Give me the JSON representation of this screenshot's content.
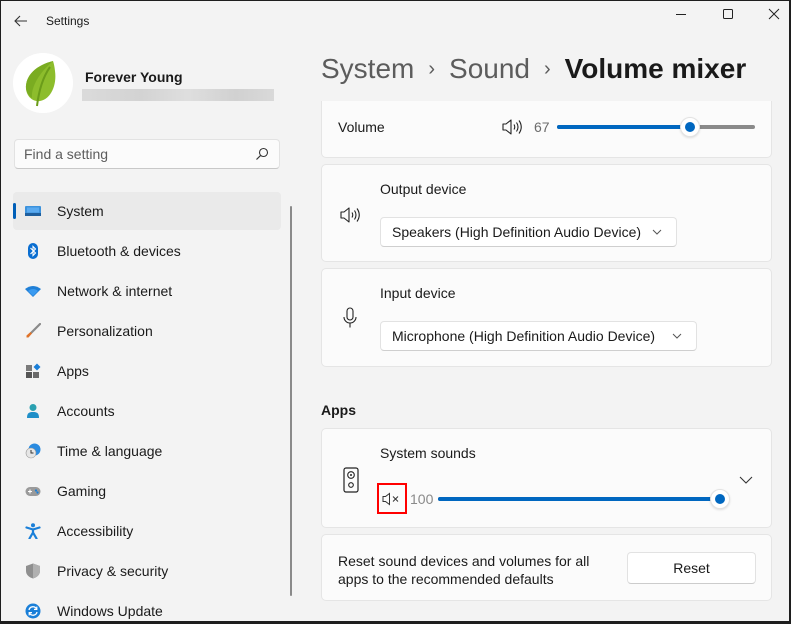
{
  "window": {
    "title": "Settings",
    "controls": {
      "minimize": "minimize-icon",
      "maximize": "maximize-icon",
      "close": "close-icon"
    }
  },
  "user": {
    "name": "Forever Young",
    "avatar_icon": "leaf-avatar"
  },
  "search": {
    "placeholder": "Find a setting",
    "value": "",
    "icon": "search-icon"
  },
  "sidebar": {
    "selected": "System",
    "items": [
      {
        "label": "System",
        "icon": "system-icon"
      },
      {
        "label": "Bluetooth & devices",
        "icon": "bluetooth-icon"
      },
      {
        "label": "Network & internet",
        "icon": "network-icon"
      },
      {
        "label": "Personalization",
        "icon": "personalization-icon"
      },
      {
        "label": "Apps",
        "icon": "apps-icon"
      },
      {
        "label": "Accounts",
        "icon": "accounts-icon"
      },
      {
        "label": "Time & language",
        "icon": "time-language-icon"
      },
      {
        "label": "Gaming",
        "icon": "gaming-icon"
      },
      {
        "label": "Accessibility",
        "icon": "accessibility-icon"
      },
      {
        "label": "Privacy & security",
        "icon": "privacy-security-icon"
      },
      {
        "label": "Windows Update",
        "icon": "windows-update-icon"
      }
    ]
  },
  "breadcrumb": {
    "items": [
      "System",
      "Sound",
      "Volume mixer"
    ],
    "separator": "›"
  },
  "main": {
    "volume": {
      "label": "Volume",
      "icon": "speaker-icon",
      "value": 67,
      "max": 100
    },
    "output_device": {
      "label": "Output device",
      "icon": "speaker-icon",
      "selected": "Speakers (High Definition Audio Device)"
    },
    "input_device": {
      "label": "Input device",
      "icon": "microphone-icon",
      "selected": "Microphone (High Definition Audio Device)"
    },
    "apps_heading": "Apps",
    "system_sounds": {
      "label": "System sounds",
      "icon": "speaker-box-icon",
      "mute_icon": "speaker-muted-icon",
      "value": 100,
      "max": 100,
      "value_text": "100",
      "highlighted": true
    },
    "reset": {
      "description_line1": "Reset sound devices and volumes for all",
      "description_line2": "apps to the recommended defaults",
      "button_label": "Reset"
    }
  },
  "colors": {
    "accent": "#0067c0",
    "highlight": "#ff0000",
    "background": "#f3f3f3",
    "card": "#fbfbfb"
  }
}
